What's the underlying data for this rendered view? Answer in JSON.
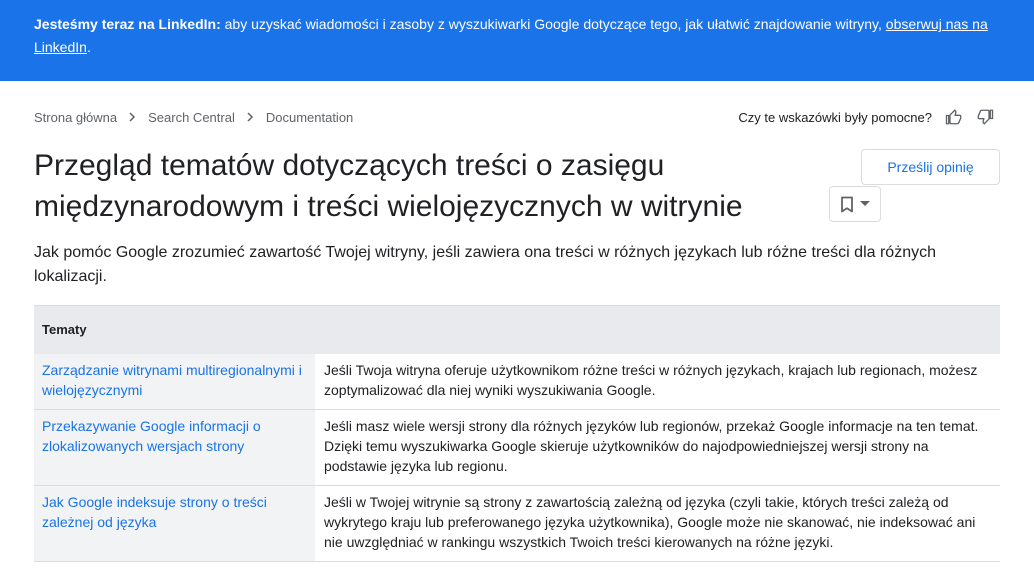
{
  "banner": {
    "bold": "Jesteśmy teraz na LinkedIn:",
    "text": " aby uzyskać wiadomości i zasoby z wyszukiwarki Google dotyczące tego, jak ułatwić znajdowanie witryny, ",
    "link": "obserwuj nas na LinkedIn",
    "end": "."
  },
  "breadcrumb": [
    "Strona główna",
    "Search Central",
    "Documentation"
  ],
  "feedback": {
    "question": "Czy te wskazówki były pomocne?",
    "thumbs_up_icon": "thumb-up-icon",
    "thumbs_down_icon": "thumb-down-icon"
  },
  "page": {
    "title": "Przegląd tematów dotyczących treści o zasięgu międzynarodowym i treści wielojęzycznych w witrynie",
    "send_feedback": "Prześlij opinię",
    "bookmark_icon": "bookmark-icon",
    "dropdown_icon": "arrow-drop-down-icon",
    "intro": "Jak pomóc Google zrozumieć zawartość Twojej witryny, jeśli zawiera ona treści w różnych językach lub różne treści dla różnych lokalizacji."
  },
  "table": {
    "header": "Tematy",
    "rows": [
      {
        "topic": "Zarządzanie witrynami multiregionalnymi i wielojęzycznymi",
        "desc": "Jeśli Twoja witryna oferuje użytkownikom różne treści w różnych językach, krajach lub regionach, możesz zoptymalizować dla niej wyniki wyszukiwania Google."
      },
      {
        "topic": "Przekazywanie Google informacji o zlokalizowanych wersjach strony",
        "desc": "Jeśli masz wiele wersji strony dla różnych języków lub regionów, przekaż Google informacje na ten temat. Dzięki temu wyszukiwarka Google skieruje użytkowników do najodpowiedniejszej wersji strony na podstawie języka lub regionu."
      },
      {
        "topic": "Jak Google indeksuje strony o treści zależnej od języka",
        "desc": "Jeśli w Twojej witrynie są strony z zawartością zależną od języka (czyli takie, których treści zależą od wykrytego kraju lub preferowanego języka użytkownika), Google może nie skanować, nie indeksować ani nie uwzględniać w rankingu wszystkich Twoich treści kierowanych na różne języki."
      }
    ]
  },
  "colors": {
    "accent": "#1a73e8",
    "banner_bg": "#1a73e8",
    "table_header_bg": "#e8eaed",
    "topic_cell_bg": "#f1f3f4"
  }
}
